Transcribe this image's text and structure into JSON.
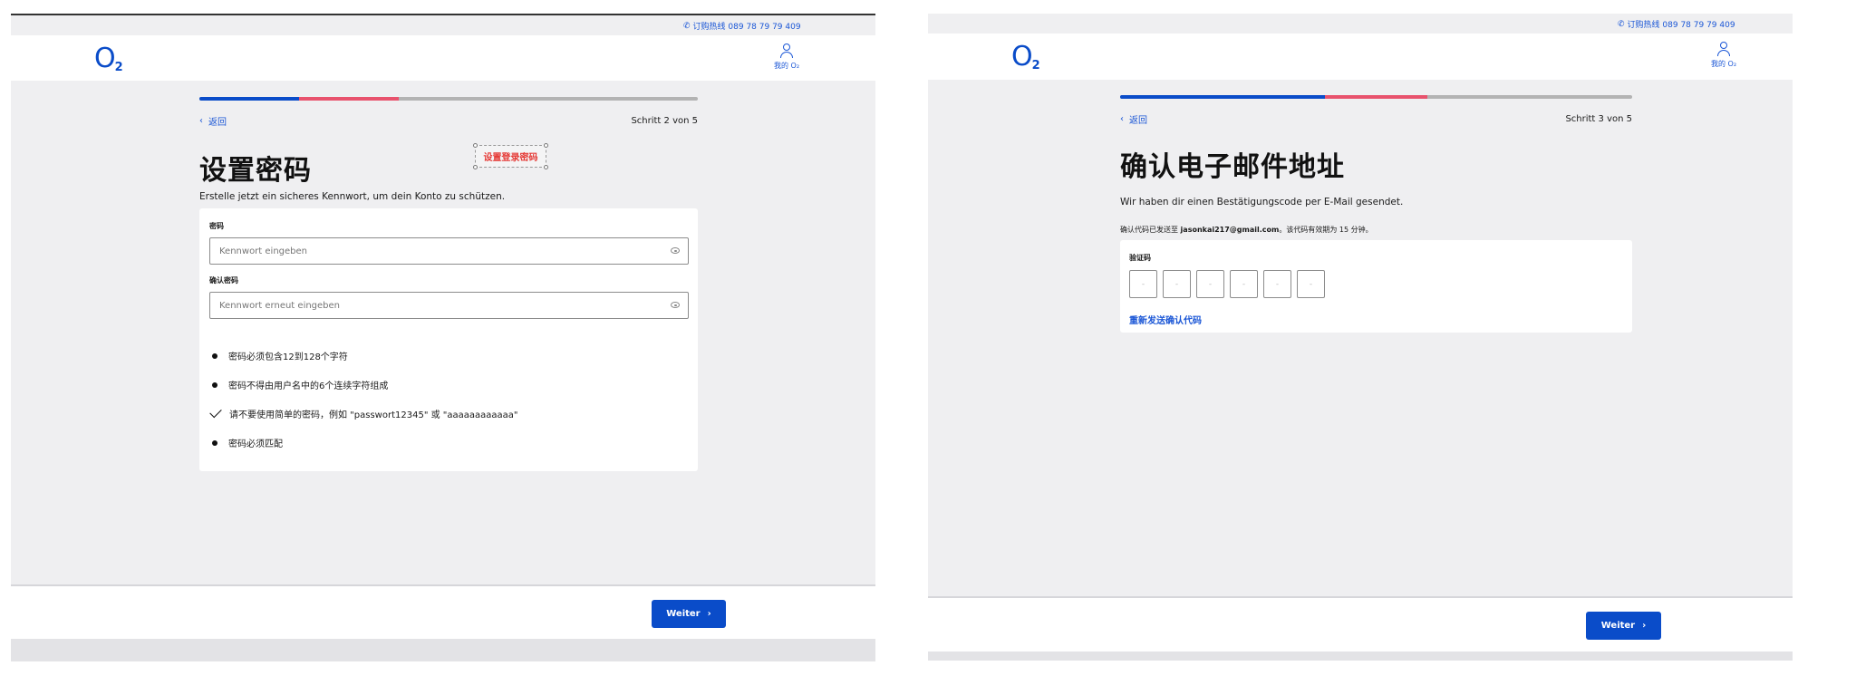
{
  "colors": {
    "brand_blue": "#0a4cc9",
    "link_blue": "#1a56d6",
    "progress_pink": "#e8526d",
    "progress_grey": "#b3b3b3",
    "annotation_red": "#e53935",
    "page_bg": "#efeff1"
  },
  "hotline": {
    "icon": "phone-icon",
    "text": "订购热线 089 78 79 79 409"
  },
  "logo": {
    "letter": "O",
    "subscript": "2"
  },
  "my_o2": {
    "icon": "user-icon",
    "label": "我的 O₂"
  },
  "screen_password": {
    "progress": {
      "blue_fraction": 0.2,
      "pink_fraction": 0.2
    },
    "back_label": "返回",
    "step_label": "Schritt 2 von 5",
    "title": "设置密码",
    "annotation_text": "设置登录密码",
    "lead": "Erstelle jetzt ein sicheres Kennwort, um dein Konto zu schützen.",
    "password_label": "密码",
    "password_placeholder": "Kennwort eingeben",
    "confirm_label": "确认密码",
    "confirm_placeholder": "Kennwort erneut eingeben",
    "rules": [
      {
        "icon": "bullet-icon",
        "text": "密码必须包含12到128个字符"
      },
      {
        "icon": "bullet-icon",
        "text": "密码不得由用户名中的6个连续字符组成"
      },
      {
        "icon": "check-icon",
        "text": "请不要使用简单的密码，例如 \"passwort12345\" 或 \"aaaaaaaaaaaa\""
      },
      {
        "icon": "bullet-icon",
        "text": "密码必须匹配"
      }
    ],
    "next_label": "Weiter"
  },
  "screen_email": {
    "progress": {
      "blue_fraction": 0.4,
      "pink_fraction": 0.2
    },
    "back_label": "返回",
    "step_label": "Schritt 3 von 5",
    "title": "确认电子邮件地址",
    "lead": "Wir haben dir einen Bestätigungscode per E-Mail gesendet.",
    "note_prefix": "确认代码已发送至 ",
    "note_email": "jasonkai217@gmail.com",
    "note_suffix": "。该代码有效期为 15 分钟。",
    "code_label": "验证码",
    "code_placeholders": [
      "-",
      "-",
      "-",
      "-",
      "-",
      "-"
    ],
    "resend_label": "重新发送确认代码",
    "next_label": "Weiter"
  }
}
